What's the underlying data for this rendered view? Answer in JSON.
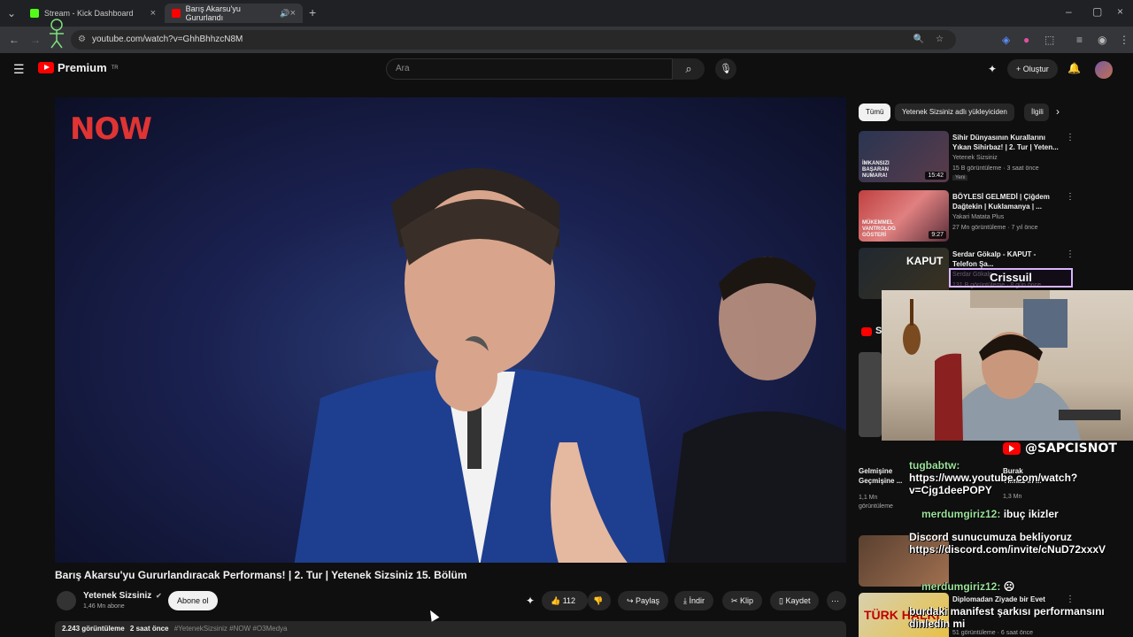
{
  "browser": {
    "tabs": [
      {
        "label": "Stream - Kick Dashboard",
        "favicon_color": "#53fc18"
      },
      {
        "label": "Barış Akarsu'yu Gururlandı",
        "favicon_color": "#ff0000"
      }
    ],
    "url": "youtube.com/watch?v=GhhBhhzcN8M"
  },
  "youtube": {
    "logo_text": "Premium",
    "logo_region": "TR",
    "search_placeholder": "Ara",
    "create_label": "Oluştur"
  },
  "video": {
    "watermark": "NOW",
    "title": "Barış Akarsu'yu Gururlandıracak Performans! | 2. Tur | Yetenek Sizsiniz 15. Bölüm",
    "channel": "Yetenek Sizsiniz",
    "channel_verified": "✔",
    "subscribers": "1,46 Mn abone",
    "subscribe_label": "Abone ol",
    "likes": "112",
    "share_label": "Paylaş",
    "download_label": "İndir",
    "clip_label": "Klip",
    "save_label": "Kaydet",
    "views": "2.243 görüntüleme",
    "age": "2 saat önce",
    "tags": "#YetenekSizsiniz #NOW #O3Medya"
  },
  "sidebar": {
    "chips": [
      "Tümü",
      "Yetenek Sizsiniz adlı yükleyiciden",
      "İlgili"
    ],
    "recommendations": [
      {
        "title": "Sihir Dünyasının Kurallarını Yıkan Sihirbaz! | 2. Tur | Yeten...",
        "channel": "Yetenek Sizsiniz",
        "meta": "15 B görüntüleme · 3 saat önce",
        "badge": "Yeni",
        "duration": "15:42",
        "thumb_text": "İMKANSIZI BAŞARAN NUMARA!"
      },
      {
        "title": "BÖYLESİ GELMEDİ | Çiğdem Dağtekin | Kuklamanya | ...",
        "channel": "Yakari Matata Plus",
        "meta": "27 Mn görüntüleme · 7 yıl önce",
        "duration": "9:27",
        "thumb_text": "MÜKEMMEL VANTROLOG GÖSTERİ"
      },
      {
        "title": "Serdar Gökalp - KAPUT - Telefon Şa...",
        "channel": "Serdar Gökalp",
        "meta": "131 B görüntüleme · 8 gün önce",
        "thumb_text": "KAPUT"
      },
      {
        "title": "Diplomadan Ziyade bir Evet",
        "channel": "",
        "meta": "51 görüntüleme · 6 saat önce",
        "thumb_text": "TÜRK HALKI"
      }
    ],
    "partial_items": [
      {
        "title": "Gelmişine Geçmişine ...",
        "meta": "1,1 Mn görüntüleme"
      },
      {
        "title": "Burak Yılmaz in ...",
        "meta": "1,3 Mn"
      }
    ],
    "section_initial": "S"
  },
  "overlay": {
    "crissuil_label": "Crissuil",
    "handle": "@SAPCISNOT",
    "chat": [
      {
        "user": "tugbabtw:",
        "text": "https://www.youtube.com/watch?v=Cjg1deePOPY"
      },
      {
        "user": "merdumgiriz12:",
        "text": "ibuç ikizler"
      },
      {
        "user": "",
        "text": "Discord sunucumuza bekliyoruz https://discord.com/invite/cNuD72xxxV"
      },
      {
        "user": "merdumgiriz12:",
        "text": "☹"
      },
      {
        "user": "",
        "text": "burdaki manifest şarkısı performansını dinledin mi"
      }
    ]
  }
}
